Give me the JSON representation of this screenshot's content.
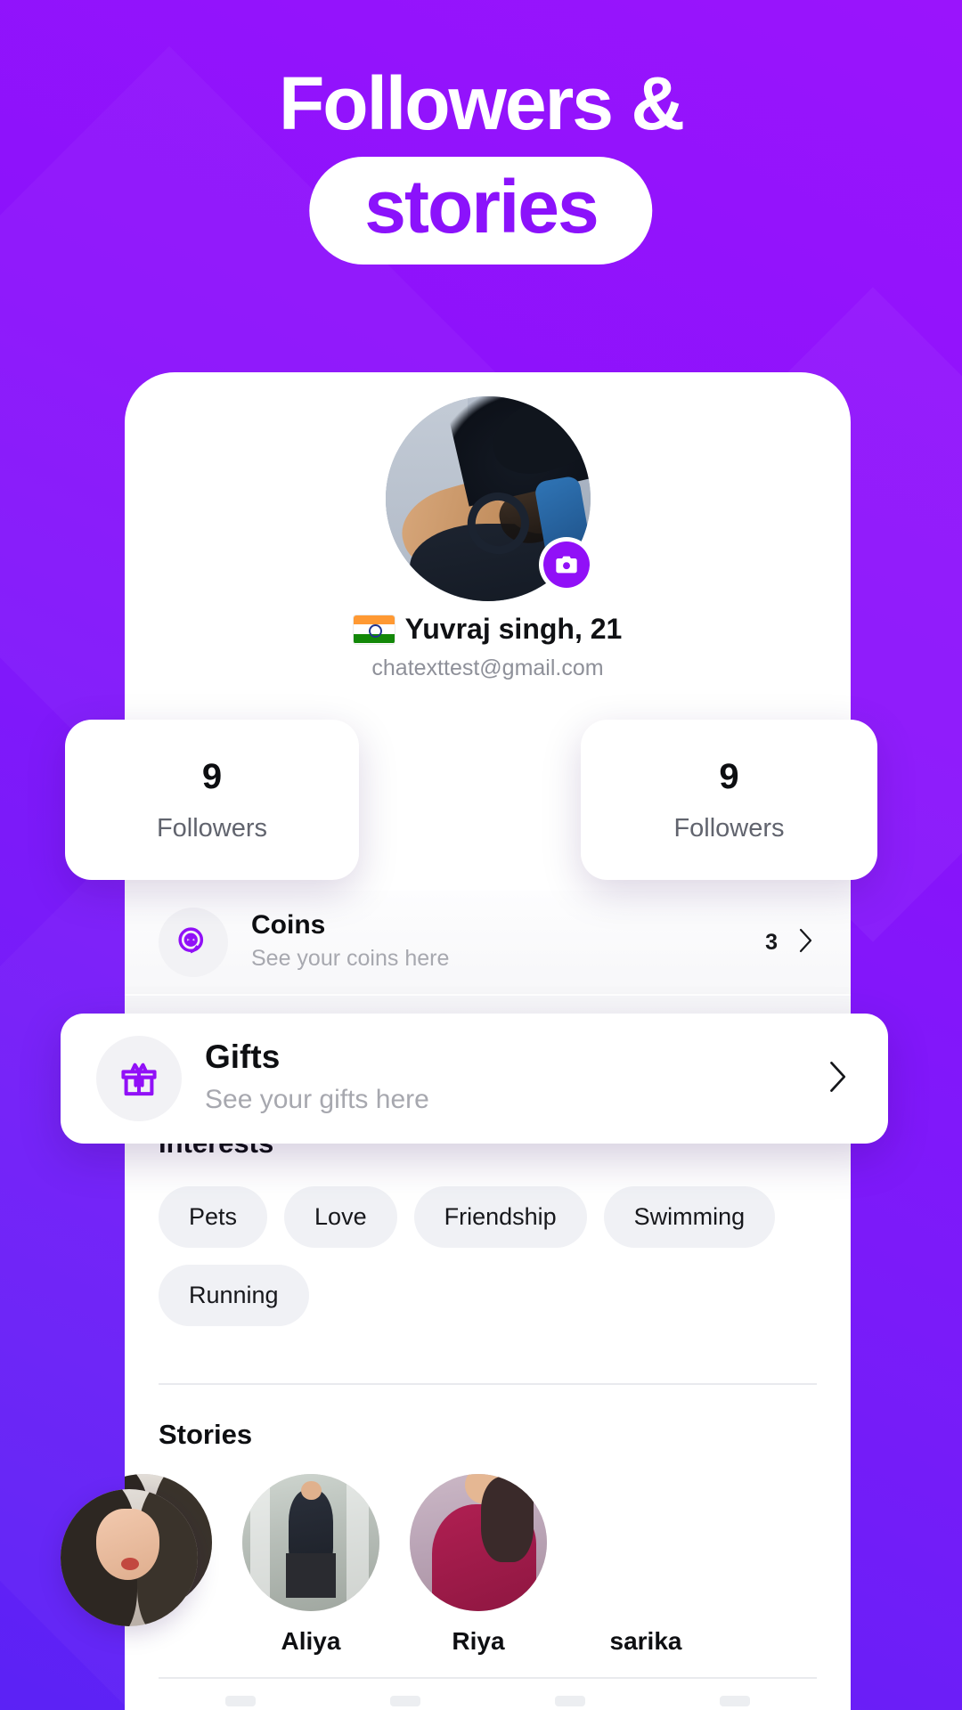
{
  "hero": {
    "line1": "Followers &",
    "line2": "stories"
  },
  "theme": {
    "brand_purple": "#8F13FB",
    "brand_purple_deep": "#5B22F5",
    "accent": "#9110F7",
    "card_white": "#FFFFFF",
    "chip_bg": "#F0F1F5",
    "muted_text": "#A7A8AF"
  },
  "profile": {
    "avatar_alt": "user-photo",
    "camera_badge_icon": "camera-icon",
    "flag_icon": "india-flag-icon",
    "name": "Yuvraj singh, 21",
    "email": "chatexttest@gmail.com"
  },
  "stats": [
    {
      "value": "9",
      "label": "Followers"
    },
    {
      "value": "9",
      "label": "Followers"
    }
  ],
  "rows": [
    {
      "icon": "coins-icon",
      "title": "Coins",
      "subtitle": "See your coins here",
      "value": "3",
      "chevron": "chevron-right-icon"
    },
    {
      "icon": "gift-icon",
      "title": "Gifts",
      "subtitle": "See your gifts here",
      "value": "",
      "chevron": "chevron-right-icon"
    }
  ],
  "interests": {
    "title": "Interests",
    "items": [
      "Pets",
      "Love",
      "Friendship",
      "Swimming",
      "Running"
    ]
  },
  "stories": {
    "title": "Stories",
    "items": [
      {
        "name": ""
      },
      {
        "name": "Aliya"
      },
      {
        "name": "Riya"
      },
      {
        "name": "sarika"
      }
    ]
  }
}
